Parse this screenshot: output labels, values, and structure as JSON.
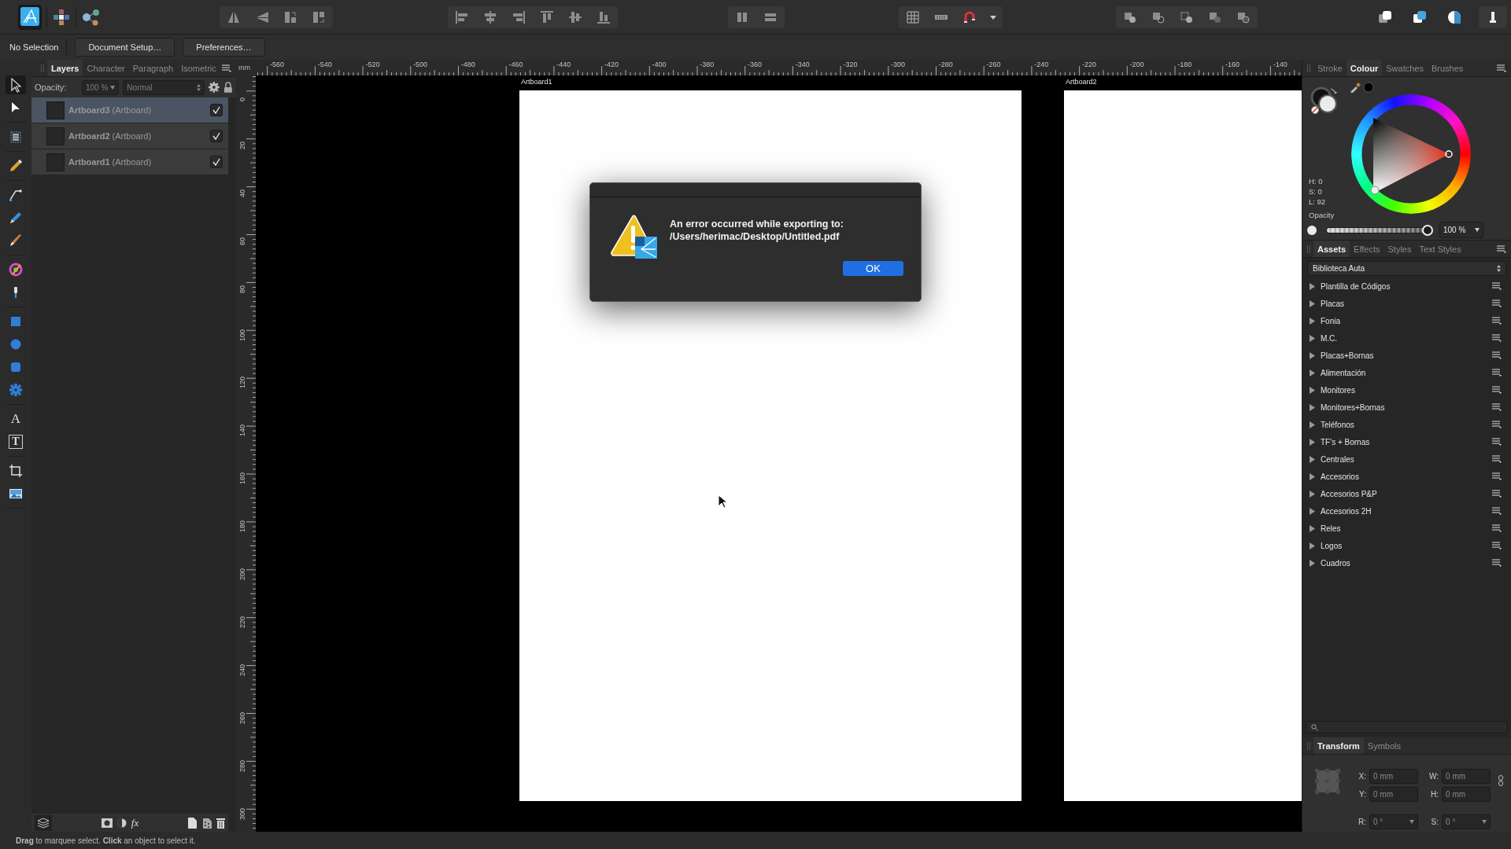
{
  "context_bar": {
    "selection_label": "No Selection",
    "buttons": [
      "Document Setup…",
      "Preferences…"
    ]
  },
  "tool_groups": [
    {
      "tools": [
        {
          "kind": "move",
          "selected": true
        },
        {
          "kind": "node",
          "selected": false
        }
      ]
    },
    {
      "tools": [
        {
          "kind": "artboard",
          "selected": false
        }
      ]
    },
    {
      "tools": [
        {
          "kind": "brush",
          "selected": false
        }
      ]
    },
    {
      "tools": [
        {
          "kind": "pen",
          "selected": false
        },
        {
          "kind": "pencil",
          "selected": false
        },
        {
          "kind": "paint-brush",
          "selected": false
        }
      ]
    },
    {
      "tools": [
        {
          "kind": "fill",
          "selected": false
        },
        {
          "kind": "transparency",
          "selected": false
        }
      ]
    },
    {
      "tools": [
        {
          "kind": "rectangle",
          "selected": false
        },
        {
          "kind": "ellipse",
          "selected": false
        },
        {
          "kind": "rounded-rectangle",
          "selected": false
        },
        {
          "kind": "cog",
          "selected": false
        }
      ]
    },
    {
      "tools": [
        {
          "kind": "text",
          "glyph": "A",
          "selected": false
        },
        {
          "kind": "frame-text",
          "glyph": "T",
          "selected": false
        }
      ]
    },
    {
      "tools": [
        {
          "kind": "crop",
          "selected": false
        },
        {
          "kind": "image",
          "selected": false
        }
      ]
    }
  ],
  "layers_panel": {
    "tabs": [
      {
        "label": "Layers",
        "selected": true
      },
      {
        "label": "Character",
        "selected": false
      },
      {
        "label": "Paragraph",
        "selected": false
      },
      {
        "label": "Isometric",
        "selected": false
      }
    ],
    "opacity_label": "Opacity:",
    "opacity_value": "100 %",
    "blend_mode": "Normal",
    "layers": [
      {
        "label": "**Artboard3** (Artboard)",
        "visible": true,
        "selected": true
      },
      {
        "label": "**Artboard2** (Artboard)",
        "visible": true,
        "selected": false
      },
      {
        "label": "**Artboard1** (Artboard)",
        "visible": true,
        "selected": false
      }
    ],
    "footer_fx": "fx"
  },
  "rulers": {
    "unit": "mm",
    "horizontal": [
      "-560",
      "-540",
      "-520",
      "-500",
      "-480",
      "-460",
      "-440",
      "-420",
      "-400",
      "-380",
      "-360",
      "-340",
      "-320",
      "-300",
      "-280",
      "-260",
      "-240",
      "-220",
      "-200",
      "-180",
      "-160",
      "-140"
    ],
    "vertical": [
      "0",
      "20",
      "40",
      "60",
      "80",
      "100",
      "120",
      "140",
      "160",
      "180",
      "200",
      "220",
      "240",
      "260",
      "280",
      "300"
    ]
  },
  "artboards": [
    {
      "label": "Artboard1"
    },
    {
      "label": "Artboard2"
    }
  ],
  "dialog": {
    "message": "An error occurred while exporting to:",
    "path": "/Users/herimac/Desktop/Untitled.pdf",
    "button": "OK"
  },
  "colour_panel": {
    "tabs": [
      {
        "label": "Stroke",
        "selected": false
      },
      {
        "label": "Colour",
        "selected": true
      },
      {
        "label": "Swatches",
        "selected": false
      },
      {
        "label": "Brushes",
        "selected": false
      }
    ],
    "hue": "H: 0",
    "saturation": "S: 0",
    "lightness": "L: 92",
    "opacity_label": "Opacity",
    "opacity": {
      "level": 1,
      "reading": "100 %"
    }
  },
  "assets_panel": {
    "tabs": [
      {
        "label": "Assets",
        "selected": true
      },
      {
        "label": "Effects",
        "selected": false
      },
      {
        "label": "Styles",
        "selected": false
      },
      {
        "label": "Text Styles",
        "selected": false
      }
    ],
    "library": "Biblioteca Auta",
    "categories": [
      {
        "name": "Plantilla de Códigos",
        "expanded": false
      },
      {
        "name": "Placas",
        "expanded": false
      },
      {
        "name": "Fonia",
        "expanded": false
      },
      {
        "name": "M.C.",
        "expanded": false
      },
      {
        "name": "Placas+Bornas",
        "expanded": false
      },
      {
        "name": "Alimentación",
        "expanded": false
      },
      {
        "name": "Monitores",
        "expanded": false
      },
      {
        "name": "Monitores+Bornas",
        "expanded": false
      },
      {
        "name": "Teléfonos",
        "expanded": false
      },
      {
        "name": "TF's + Bornas",
        "expanded": false
      },
      {
        "name": "Centrales",
        "expanded": false
      },
      {
        "name": "Accesorios",
        "expanded": false
      },
      {
        "name": "Accesorios P&P",
        "expanded": false
      },
      {
        "name": "Accesorios 2H",
        "expanded": false
      },
      {
        "name": "Reles",
        "expanded": false
      },
      {
        "name": "Logos",
        "expanded": false
      },
      {
        "name": "Cuadros",
        "expanded": false
      }
    ]
  },
  "transform_panel": {
    "tabs": [
      {
        "label": "Transform",
        "selected": true
      },
      {
        "label": "Symbols",
        "selected": false
      }
    ],
    "fields": [
      {
        "label": "X:",
        "value": "0 mm",
        "kind": "text"
      },
      {
        "label": "W:",
        "value": "0 mm",
        "kind": "text"
      },
      {
        "label": "Y:",
        "value": "0 mm",
        "kind": "text"
      },
      {
        "label": "H:",
        "value": "0 mm",
        "kind": "text"
      },
      {
        "label": "R:",
        "value": "0 °",
        "kind": "dropdown"
      },
      {
        "label": "S:",
        "value": "0 °",
        "kind": "dropdown"
      }
    ]
  },
  "status_bar": "**Drag** to marquee select. **Click** an object to select it."
}
